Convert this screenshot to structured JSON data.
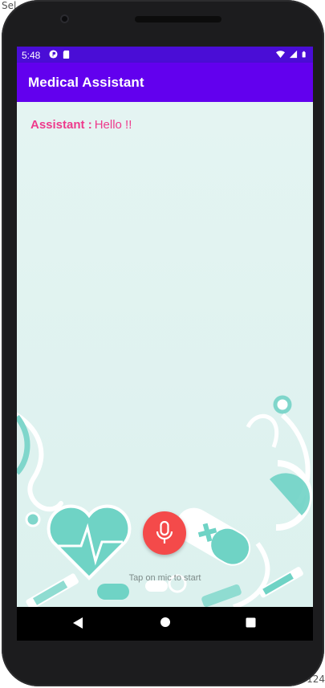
{
  "edge": {
    "left_fragment": "Sel",
    "right_fragment": "124"
  },
  "status_bar": {
    "time": "5:48",
    "icons": [
      "app-badge-icon",
      "sd-card-icon",
      "wifi-icon",
      "cell-signal-icon",
      "battery-icon"
    ]
  },
  "app_bar": {
    "title": "Medical Assistant"
  },
  "chat": {
    "messages": [
      {
        "speaker": "Assistant :",
        "text": "Hello !!"
      }
    ]
  },
  "mic": {
    "icon": "microphone-icon",
    "hint": "Tap on mic to start"
  },
  "nav": {
    "buttons": [
      "back-icon",
      "home-icon",
      "recents-icon"
    ]
  },
  "colors": {
    "status_bar": "#4a0dd6",
    "app_bar": "#6200ee",
    "assistant_text": "#ee3a8c",
    "mic_button": "#f44a4a",
    "illustration": "#6fd3c5"
  }
}
